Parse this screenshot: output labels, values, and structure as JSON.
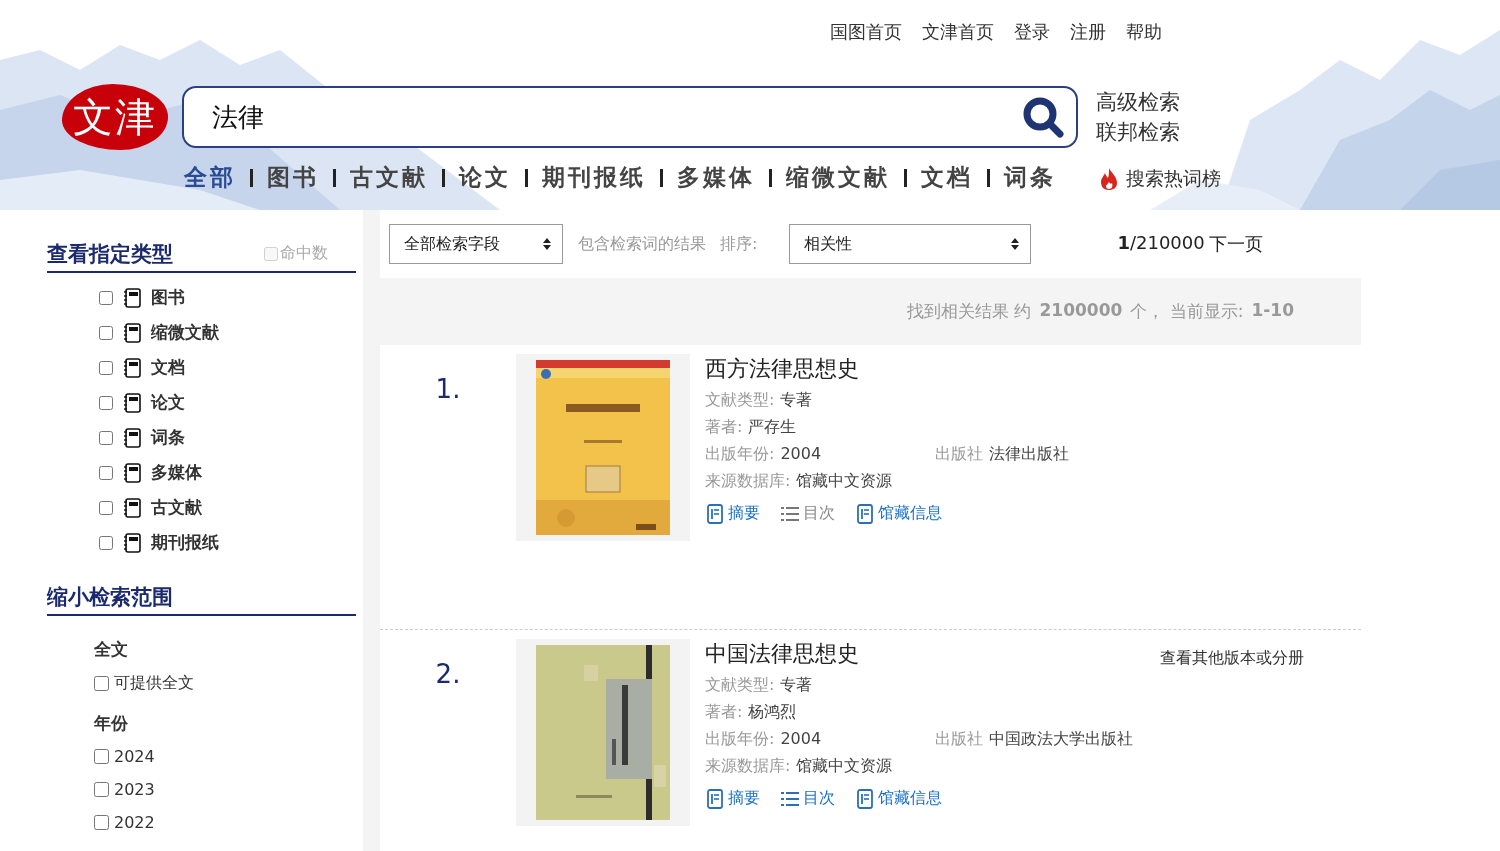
{
  "top_links": [
    "国图首页",
    "文津首页",
    "登录",
    "注册",
    "帮助"
  ],
  "logo": {
    "text": "文津"
  },
  "search": {
    "value": "法律"
  },
  "side_links": [
    "高级检索",
    "联邦检索"
  ],
  "categories": [
    {
      "label": "全部",
      "selected": true
    },
    {
      "label": "图书",
      "selected": false
    },
    {
      "label": "古文献",
      "selected": false
    },
    {
      "label": "论文",
      "selected": false
    },
    {
      "label": "期刊报纸",
      "selected": false
    },
    {
      "label": "多媒体",
      "selected": false
    },
    {
      "label": "缩微文献",
      "selected": false
    },
    {
      "label": "文档",
      "selected": false
    },
    {
      "label": "词条",
      "selected": false
    }
  ],
  "hot_words": "搜索热词榜",
  "sidebar": {
    "type_heading": "查看指定类型",
    "hit_count": {
      "label": "命中数",
      "checked": false,
      "disabled": true
    },
    "types": [
      {
        "label": "图书",
        "checked": false
      },
      {
        "label": "缩微文献",
        "checked": false
      },
      {
        "label": "文档",
        "checked": false
      },
      {
        "label": "论文",
        "checked": false
      },
      {
        "label": "词条",
        "checked": false
      },
      {
        "label": "多媒体",
        "checked": false
      },
      {
        "label": "古文献",
        "checked": false
      },
      {
        "label": "期刊报纸",
        "checked": false
      }
    ],
    "range_heading": "缩小检索范围",
    "groups": [
      {
        "title": "全文",
        "options": [
          {
            "label": "可提供全文",
            "checked": false
          }
        ]
      },
      {
        "title": "年份",
        "options": [
          {
            "label": "2024",
            "checked": false
          },
          {
            "label": "2023",
            "checked": false
          },
          {
            "label": "2022",
            "checked": false
          }
        ]
      }
    ]
  },
  "toolbar": {
    "field_select": "全部检索字段",
    "within_label": "包含检索词的结果",
    "sort_label": "排序:",
    "sort_select": "相关性",
    "page_current": "1",
    "page_total": "/210000",
    "next_page": "下一页"
  },
  "summary": {
    "prefix": "找到相关结果 约",
    "count": "2100000",
    "middle": "个，  当前显示:",
    "range": "1-10"
  },
  "results": [
    {
      "number": "1.",
      "title": "西方法律思想史",
      "type_label": "文献类型:",
      "type": "专著",
      "author_label": "著者:",
      "author": "严存生",
      "year_label": "出版年份:",
      "year": "2004",
      "publisher_label": "出版社",
      "publisher": "法律出版社",
      "source_label": "来源数据库:",
      "source": "馆藏中文资源",
      "links": [
        {
          "kind": "abstract",
          "label": "摘要",
          "disabled": false
        },
        {
          "kind": "toc",
          "label": "目次",
          "disabled": true
        },
        {
          "kind": "holdings",
          "label": "馆藏信息",
          "disabled": false
        }
      ]
    },
    {
      "number": "2.",
      "title": "中国法律思想史",
      "other_versions": "查看其他版本或分册",
      "type_label": "文献类型:",
      "type": "专著",
      "author_label": "著者:",
      "author": "杨鸿烈",
      "year_label": "出版年份:",
      "year": "2004",
      "publisher_label": "出版社",
      "publisher": "中国政法大学出版社",
      "source_label": "来源数据库:",
      "source": "馆藏中文资源",
      "links": [
        {
          "kind": "abstract",
          "label": "摘要",
          "disabled": false
        },
        {
          "kind": "toc",
          "label": "目次",
          "disabled": false
        },
        {
          "kind": "holdings",
          "label": "馆藏信息",
          "disabled": false
        }
      ]
    }
  ]
}
